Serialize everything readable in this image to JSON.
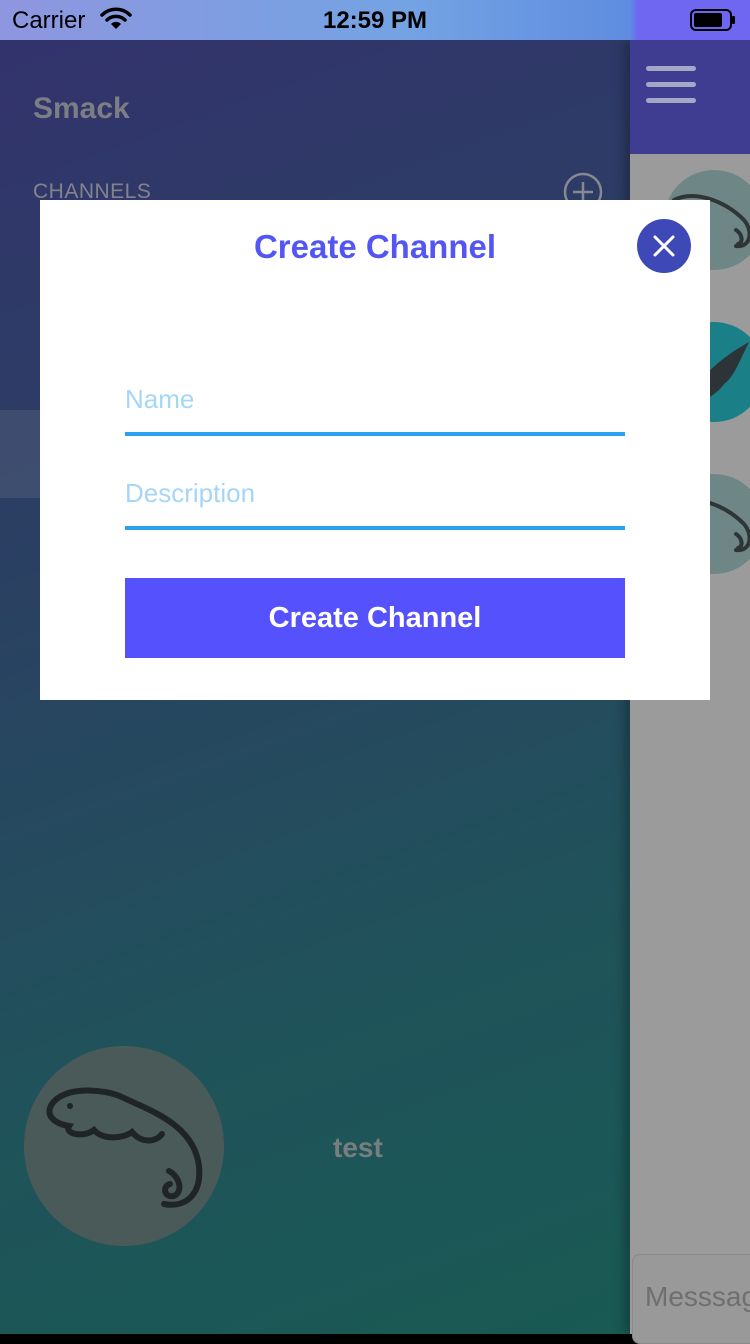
{
  "status_bar": {
    "carrier": "Carrier",
    "time": "12:59 PM"
  },
  "menu": {
    "app_title": "Smack",
    "channels_label": "CHANNELS",
    "user_name": "test"
  },
  "chat": {
    "message_placeholder": "Messsage"
  },
  "modal": {
    "title": "Create Channel",
    "name_placeholder": "Name",
    "description_placeholder": "Description",
    "create_button_label": "Create Channel"
  },
  "icons": {
    "close": "close-icon",
    "add": "plus-circle-icon",
    "menu": "hamburger-icon"
  },
  "colors": {
    "accent": "#5551fc",
    "title": "#5356f2",
    "field_underline": "#2aa0f1",
    "close_button": "#3e49b7"
  }
}
